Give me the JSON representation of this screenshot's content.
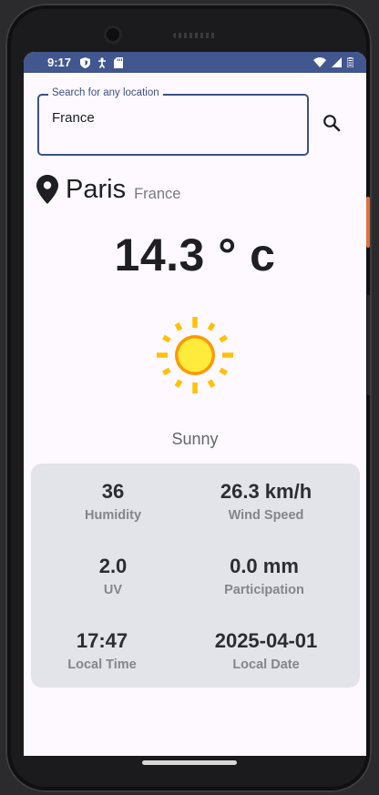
{
  "status_bar": {
    "time": "9:17"
  },
  "search": {
    "label": "Search for any location",
    "value": "France"
  },
  "location": {
    "city": "Paris",
    "country": "France"
  },
  "weather": {
    "temperature": "14.3 ° c",
    "condition": "Sunny"
  },
  "details": [
    {
      "value": "36",
      "label": "Humidity"
    },
    {
      "value": "26.3 km/h",
      "label": "Wind Speed"
    },
    {
      "value": "2.0",
      "label": "UV"
    },
    {
      "value": "0.0 mm",
      "label": "Participation"
    },
    {
      "value": "17:47",
      "label": "Local Time"
    },
    {
      "value": "2025-04-01",
      "label": "Local Date"
    }
  ],
  "colors": {
    "status_bar": "#42568f",
    "accent": "#3c5185",
    "sun": "#ffc107",
    "card": "#e3e3ea"
  }
}
